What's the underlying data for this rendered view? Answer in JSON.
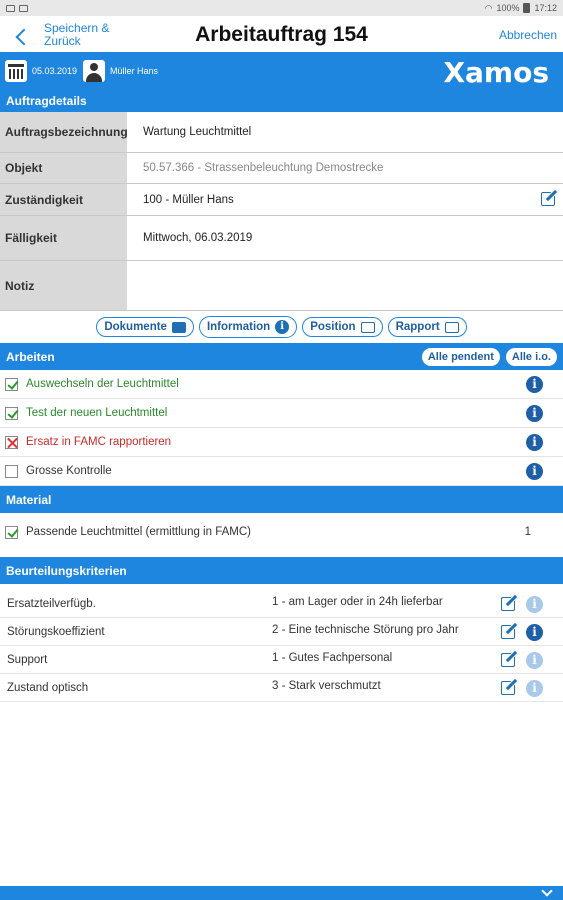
{
  "status_bar": {
    "battery": "100%",
    "time": "17:12"
  },
  "nav": {
    "back_label": "Speichern & Zurück",
    "title": "Arbeitauftrag 154",
    "cancel_label": "Abbrechen"
  },
  "header": {
    "date": "05.03.2019",
    "user": "Müller Hans",
    "logo": "Xamos"
  },
  "auftragdetails": {
    "title": "Auftragdetails",
    "rows": [
      {
        "label": "Auftragsbezeichnung",
        "value": "Wartung Leuchtmittel"
      },
      {
        "label": "Objekt",
        "value": "50.57.366 - Strassenbeleuchtung Demostrecke"
      },
      {
        "label": "Zuständigkeit",
        "value": "100 - Müller Hans"
      },
      {
        "label": "Fälligkeit",
        "value": "Mittwoch, 06.03.2019"
      },
      {
        "label": "Notiz",
        "value": ""
      }
    ]
  },
  "pills": {
    "dokumente": "Dokumente",
    "information": "Information",
    "position": "Position",
    "rapport": "Rapport"
  },
  "arbeiten": {
    "title": "Arbeiten",
    "btn_pending": "Alle pendent",
    "btn_ok": "Alle i.o.",
    "tasks": [
      {
        "text": "Auswechseln der Leuchtmittel",
        "state": "done"
      },
      {
        "text": "Test der neuen Leuchtmittel",
        "state": "done"
      },
      {
        "text": "Ersatz in FAMC rapportieren",
        "state": "failed"
      },
      {
        "text": "Grosse Kontrolle",
        "state": "open"
      }
    ]
  },
  "material": {
    "title": "Material",
    "items": [
      {
        "text": "Passende Leuchtmittel (ermittlung in FAMC)",
        "qty": "1",
        "state": "done"
      }
    ]
  },
  "beurteilung": {
    "title": "Beurteilungskriterien",
    "rows": [
      {
        "name": "Ersatzteilverfügb.",
        "value": "1 - am Lager oder in 24h lieferbar"
      },
      {
        "name": "Störungskoeffizient",
        "value": "2 - Eine technische Störung pro Jahr"
      },
      {
        "name": "Support",
        "value": "1 - Gutes Fachpersonal"
      },
      {
        "name": "Zustand optisch",
        "value": "3 - Stark verschmutzt"
      }
    ]
  },
  "colors": {
    "accent": "#1f86e0",
    "done": "#2a8a2a",
    "failed": "#cc2a2a"
  }
}
